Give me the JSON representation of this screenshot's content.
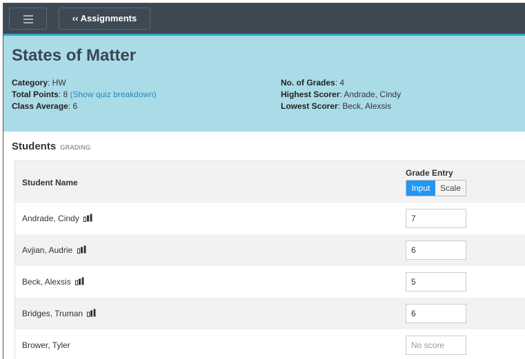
{
  "topbar": {
    "back_label": "‹‹ Assignments"
  },
  "header": {
    "title": "States of Matter",
    "category_label": "Category",
    "category_value": ": HW",
    "total_points_label": "Total Points",
    "total_points_value": ": 8 ",
    "quiz_breakdown_link": "(Show quiz breakdown)",
    "class_average_label": "Class Average",
    "class_average_value": ": 6",
    "num_grades_label": "No. of Grades",
    "num_grades_value": ": 4",
    "highest_label": "Highest Scorer",
    "highest_value": ": Andrade, Cindy",
    "lowest_label": "Lowest Scorer",
    "lowest_value": ": Beck, Alexsis"
  },
  "students": {
    "heading": "Students",
    "subheading": "GRADING",
    "col_name": "Student Name",
    "col_grade": "Grade Entry",
    "toggle_input": "Input",
    "toggle_scale": "Scale",
    "rows": [
      {
        "name": "Andrade, Cindy",
        "score": "7"
      },
      {
        "name": "Avjian, Audrie",
        "score": "6"
      },
      {
        "name": "Beck, Alexsis",
        "score": "5"
      },
      {
        "name": "Bridges, Truman",
        "score": "6"
      },
      {
        "name": "Brower, Tyler",
        "score_placeholder": "No score"
      }
    ]
  },
  "colors": {
    "topbar": "#3d4a54",
    "header_bg": "#aadce8",
    "accent": "#2196f3",
    "link": "#2a86b8"
  }
}
